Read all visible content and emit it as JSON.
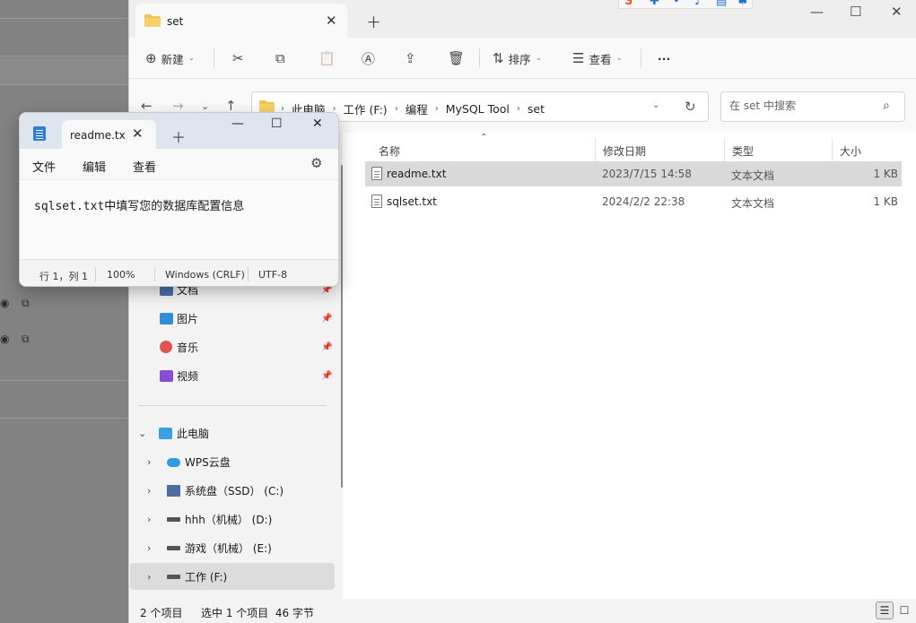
{
  "explorer": {
    "tab_title": "set",
    "toolbar": {
      "new_label": "新建",
      "sort_label": "排序",
      "view_label": "查看",
      "more_label": "···"
    },
    "breadcrumbs": [
      "此电脑",
      "工作 (F:)",
      "编程",
      "MySQL Tool",
      "set"
    ],
    "search_placeholder": "在 set 中搜索",
    "columns": {
      "name": "名称",
      "date": "修改日期",
      "type": "类型",
      "size": "大小"
    },
    "files": [
      {
        "name": "readme.txt",
        "date": "2023/7/15 14:58",
        "type": "文本文档",
        "size": "1 KB",
        "selected": true
      },
      {
        "name": "sqlset.txt",
        "date": "2024/2/2 22:38",
        "type": "文本文档",
        "size": "1 KB",
        "selected": false
      }
    ],
    "sidebar": {
      "pinned": [
        "文档",
        "图片",
        "音乐",
        "视频"
      ],
      "this_pc": "此电脑",
      "drives": [
        "WPS云盘",
        "系统盘（SSD） (C:)",
        "hhh（机械） (D:)",
        "游戏（机械） (E:)",
        "工作 (F:)"
      ]
    },
    "status": {
      "item_count": "2 个项目",
      "selection": "选中 1 个项目  46 字节"
    }
  },
  "notepad": {
    "tab_title": "readme.txt",
    "menus": [
      "文件",
      "编辑",
      "查看"
    ],
    "content": "sqlset.txt中填写您的数据库配置信息",
    "status": {
      "position": "行 1，列 1",
      "zoom": "100%",
      "line_ending": "Windows (CRLF)",
      "encoding": "UTF-8"
    }
  },
  "colors": {
    "folder": "#f2c14e",
    "selected_row": "#d9d9d9",
    "notepad_titlebar": "#dee5ee",
    "notepad_icon": "#2e7dd6"
  }
}
